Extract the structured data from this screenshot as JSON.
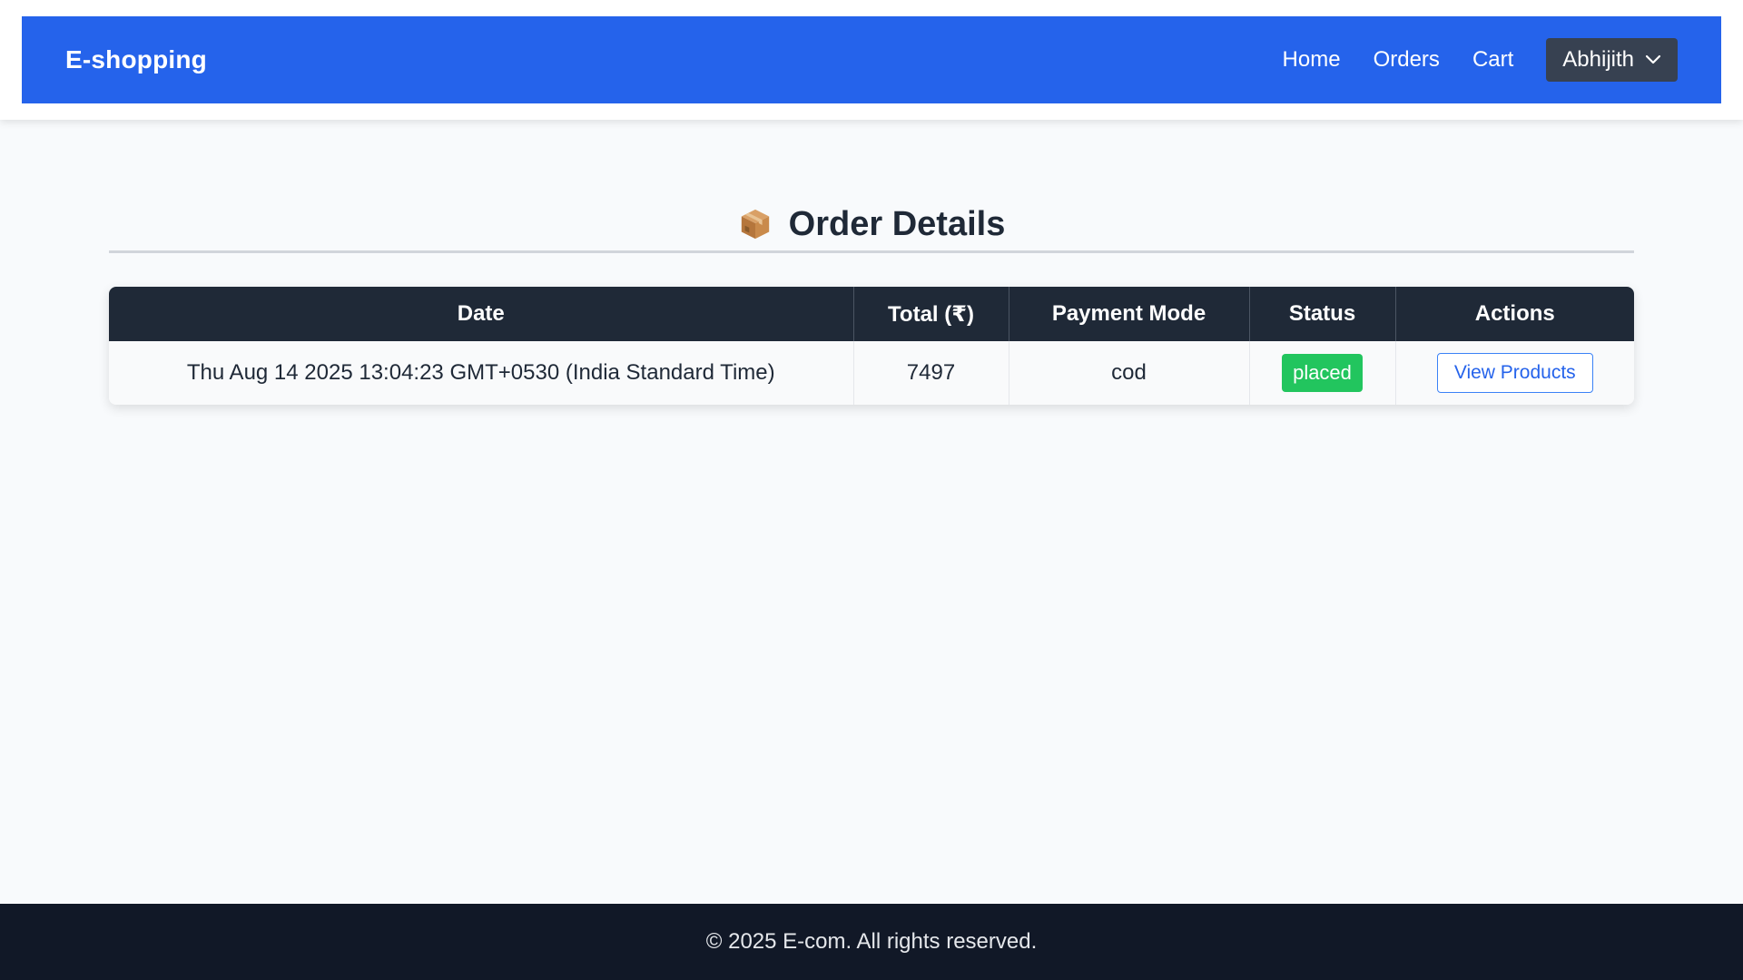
{
  "navbar": {
    "brand": "E-shopping",
    "links": [
      "Home",
      "Orders",
      "Cart"
    ],
    "user_name": "Abhijith",
    "user_icon": "chevron-down-icon",
    "bg_color": "#2563eb"
  },
  "main": {
    "title": "Order Details",
    "title_icon": "package-icon",
    "table": {
      "headers": [
        "Date",
        "Total (₹)",
        "Payment Mode",
        "Status",
        "Actions"
      ],
      "rows": [
        {
          "date": "Thu Aug 14 2025 13:04:23 GMT+0530 (India Standard Time)",
          "total": "7497",
          "payment_mode": "cod",
          "status": "placed",
          "action_label": "View Products"
        }
      ]
    }
  },
  "footer": {
    "text": "© 2025 E-com. All rights reserved."
  },
  "colors": {
    "primary": "#2563eb",
    "header_dark": "#1f2937",
    "status_placed": "#22c55e",
    "footer_bg": "#111827"
  }
}
